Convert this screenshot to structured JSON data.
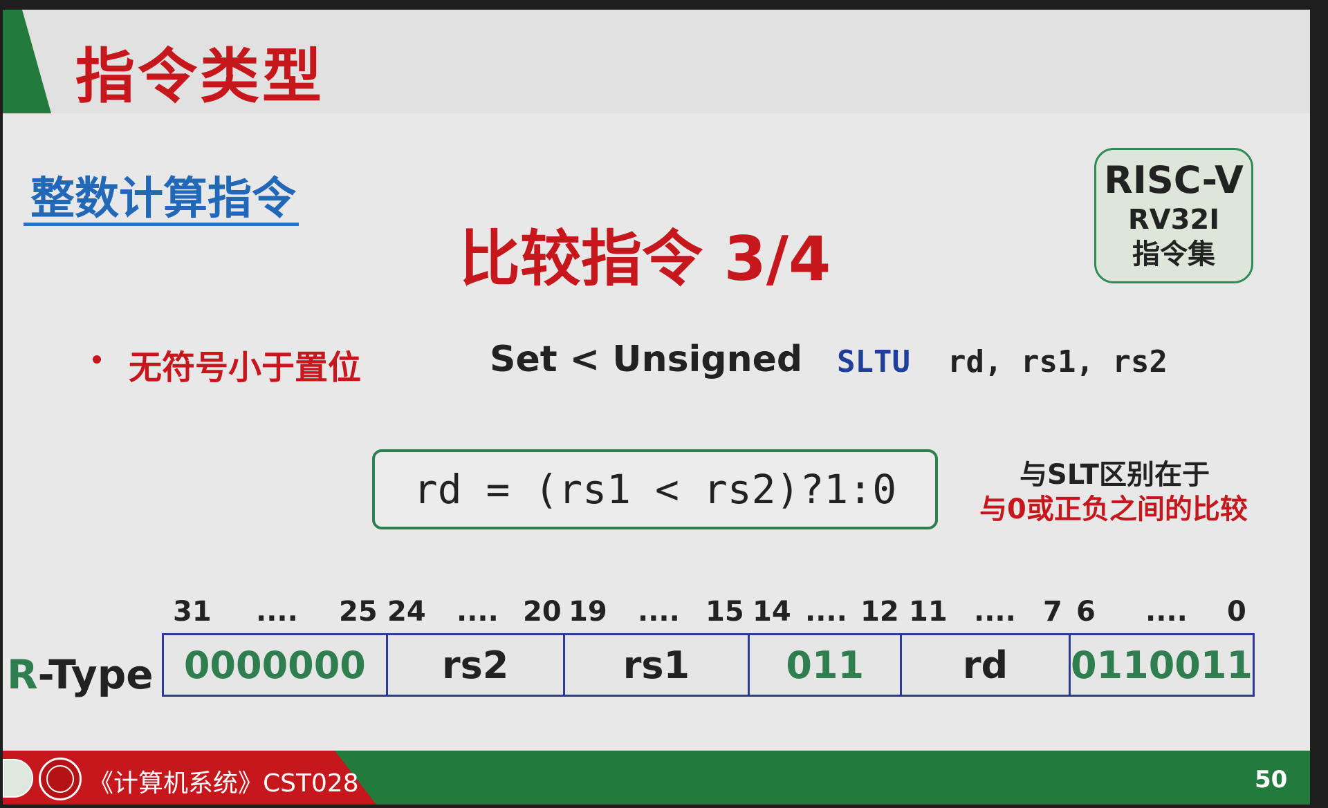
{
  "header": {
    "title": "指令类型"
  },
  "section": {
    "title": "整数计算指令"
  },
  "main": {
    "title": "比较指令 3/4"
  },
  "badge": {
    "line1": "RISC-V",
    "line2": "RV32I",
    "line3": "指令集"
  },
  "instruction": {
    "bullet": "无符号小于置位",
    "english": "Set < Unsigned",
    "mnemonic": "SLTU",
    "operands": "rd, rs1, rs2",
    "formula": "rd = (rs1 < rs2)?1:0"
  },
  "note": {
    "line1": "与SLT区别在于",
    "line2": "与0或正负之间的比较"
  },
  "encoding": {
    "type_prefix": "R",
    "type_suffix": "-Type",
    "bit_labels": [
      "31",
      "....",
      "25",
      "24",
      "....",
      "20",
      "19",
      "....",
      "15",
      "14",
      "....",
      "12",
      "11",
      "....",
      "7",
      "6",
      "....",
      "0"
    ],
    "fields": [
      "0000000",
      "rs2",
      "rs1",
      "011",
      "rd",
      "0110011"
    ]
  },
  "footer": {
    "course": "《计算机系统》CST028",
    "page": "50"
  },
  "colors": {
    "red": "#c6171c",
    "green": "#237a3d",
    "blue": "#2169b8",
    "table_border": "#2e3a9a"
  },
  "icons": [
    "university-logo-icon",
    "school-seal-icon"
  ]
}
